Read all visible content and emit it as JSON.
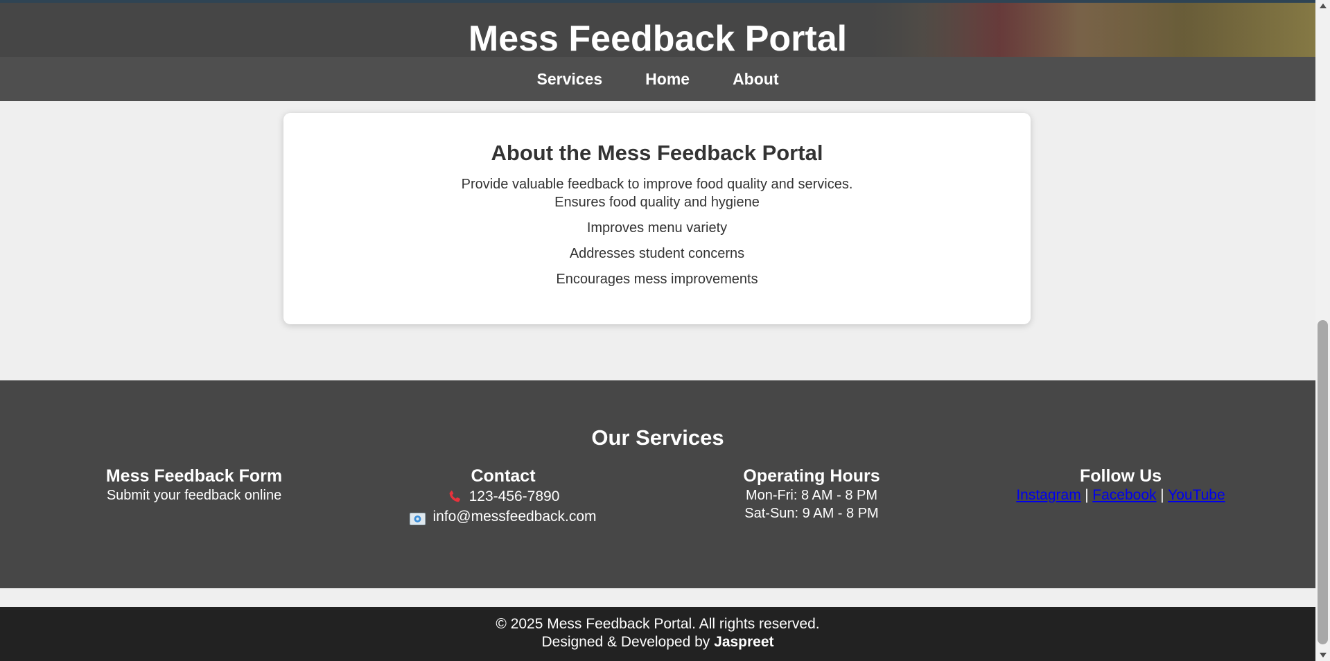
{
  "header": {
    "title": "Mess Feedback Portal"
  },
  "nav": {
    "items": [
      {
        "label": "Services"
      },
      {
        "label": "Home"
      },
      {
        "label": "About"
      }
    ]
  },
  "about": {
    "title": "About the Mess Feedback Portal",
    "intro": "Provide valuable feedback to improve food quality and services.",
    "points": [
      "Ensures food quality and hygiene",
      "Improves menu variety",
      "Addresses student concerns",
      "Encourages mess improvements"
    ]
  },
  "services": {
    "title": "Our Services",
    "form": {
      "heading": "Mess Feedback Form",
      "text": "Submit your feedback online"
    },
    "contact": {
      "heading": "Contact",
      "phone": "123-456-7890",
      "email": "info@messfeedback.com",
      "phone_icon": "phone-icon",
      "email_icon": "envelope-icon"
    },
    "hours": {
      "heading": "Operating Hours",
      "weekdays": "Mon-Fri: 8 AM - 8 PM",
      "weekend": "Sat-Sun: 9 AM - 8 PM"
    },
    "social": {
      "heading": "Follow Us",
      "links": [
        "Instagram",
        "Facebook",
        "YouTube"
      ],
      "separator": "|"
    }
  },
  "footer": {
    "copyright": "© 2025 Mess Feedback Portal. All rights reserved.",
    "credit_prefix": "Designed & Developed by ",
    "credit_name": "Jaspreet"
  },
  "colors": {
    "header_bg": "#474747",
    "nav_bg": "#4f4f4f",
    "page_bg": "#efefef",
    "services_bg": "#474747",
    "footer_bg": "#222222",
    "link": "#0000ee"
  }
}
